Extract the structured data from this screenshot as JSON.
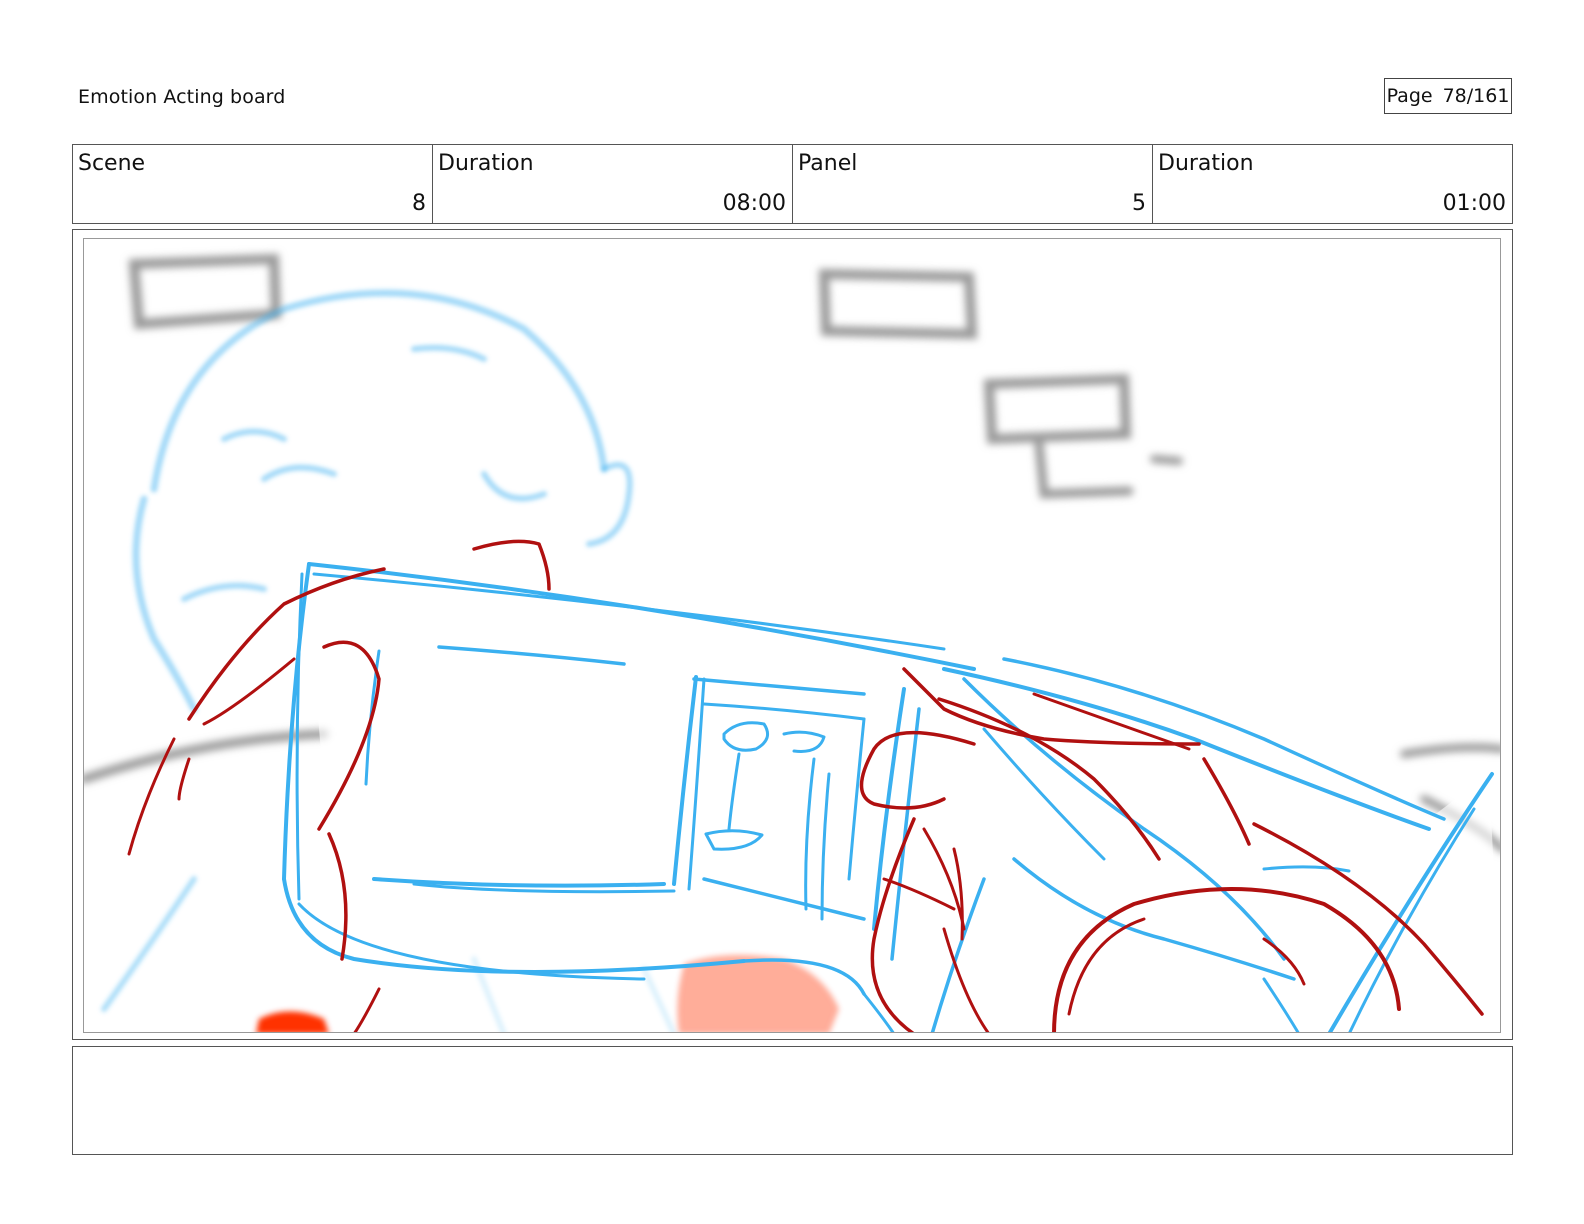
{
  "header": {
    "title": "Emotion Acting board",
    "page_label": "Page",
    "page_value": "78/161"
  },
  "info": {
    "scene_label": "Scene",
    "scene_value": "8",
    "scene_duration_label": "Duration",
    "scene_duration_value": "08:00",
    "panel_label": "Panel",
    "panel_value": "5",
    "panel_duration_label": "Duration",
    "panel_duration_value": "01:00"
  },
  "notes": {
    "text": ""
  },
  "colors": {
    "sketch_blue": "#3ab0f0",
    "sketch_red": "#b01010",
    "accent_orange": "#ff3000",
    "background_gray": "#9a9a9a"
  }
}
